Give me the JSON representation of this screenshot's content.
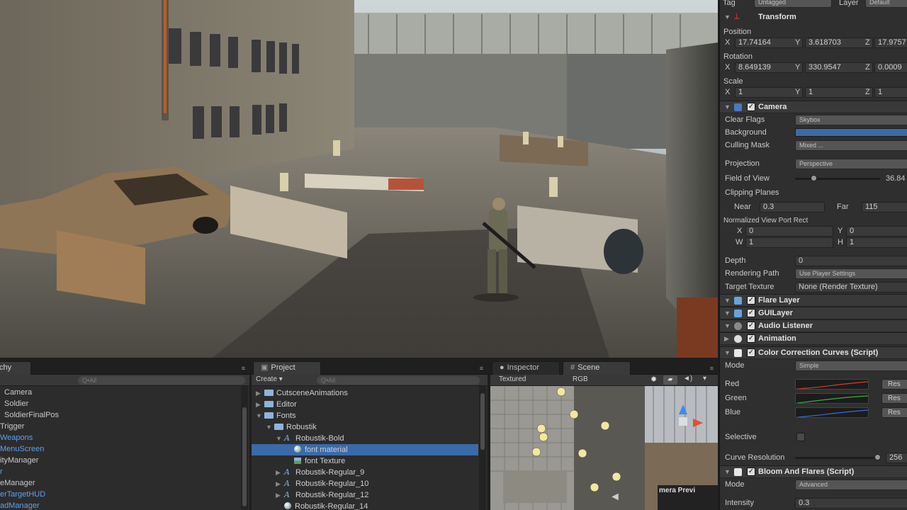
{
  "inspector": {
    "top": {
      "tag_label": "Tag",
      "tag_value": "Untagged",
      "layer_label": "Layer",
      "layer_value": "Default"
    },
    "transform": {
      "title": "Transform",
      "position_label": "Position",
      "position": {
        "x": "17.74164",
        "y": "3.618703",
        "z": "17.9757"
      },
      "rotation_label": "Rotation",
      "rotation": {
        "x": "8.649139",
        "y": "330.9547",
        "z": "0.0009"
      },
      "scale_label": "Scale",
      "scale": {
        "x": "1",
        "y": "1",
        "z": "1"
      },
      "axis": {
        "x": "X",
        "y": "Y",
        "z": "Z"
      }
    },
    "camera": {
      "title": "Camera",
      "clear_flags_label": "Clear Flags",
      "clear_flags": "Skybox",
      "background_label": "Background",
      "background_color": "#3d6aa6",
      "culling_mask_label": "Culling Mask",
      "culling_mask": "Mixed ...",
      "projection_label": "Projection",
      "projection": "Perspective",
      "fov_label": "Field of View",
      "fov": "36.84",
      "clipping_label": "Clipping Planes",
      "near_label": "Near",
      "near": "0.3",
      "far_label": "Far",
      "far": "115",
      "viewport_label": "Normalized View Port Rect",
      "vp": {
        "x_label": "X",
        "x": "0",
        "y_label": "Y",
        "y": "0",
        "w_label": "W",
        "w": "1",
        "h_label": "H",
        "h": "1"
      },
      "depth_label": "Depth",
      "depth": "0",
      "rendering_path_label": "Rendering Path",
      "rendering_path": "Use Player Settings",
      "target_texture_label": "Target Texture",
      "target_texture": "None (Render Texture)"
    },
    "components": {
      "flare_layer": "Flare Layer",
      "gui_layer": "GUILayer",
      "audio_listener": "Audio Listener",
      "animation": "Animation",
      "color_correction": "Color Correction Curves (Script)",
      "bloom": "Bloom And Flares (Script)"
    },
    "color_correction": {
      "mode_label": "Mode",
      "mode": "Simple",
      "red_label": "Red",
      "green_label": "Green",
      "blue_label": "Blue",
      "reset": "Res",
      "selective_label": "Selective",
      "curve_res_label": "Curve Resolution",
      "curve_res": "256"
    },
    "bloom": {
      "mode_label": "Mode",
      "mode": "Advanced",
      "intensity_label": "Intensity",
      "intensity": "0.3"
    }
  },
  "hierarchy": {
    "tab": "chy",
    "search_placeholder": "Q•All",
    "items": [
      {
        "label": "Camera",
        "color": "#c8c8c8"
      },
      {
        "label": "Soldier",
        "color": "#c8c8c8"
      },
      {
        "label": "SoldierFinalPos",
        "color": "#c8c8c8"
      },
      {
        "label": "Trigger",
        "color": "#c8c8c8"
      },
      {
        "label": "Weapons",
        "color": "#5fa0f0"
      },
      {
        "label": "MenuScreen",
        "color": "#5fa0f0"
      },
      {
        "label": "ityManager",
        "color": "#c8c8c8"
      },
      {
        "label": "r",
        "color": "#5fa0f0"
      },
      {
        "label": "eManager",
        "color": "#c8c8c8"
      },
      {
        "label": "erTargetHUD",
        "color": "#5fa0f0"
      },
      {
        "label": "adManager",
        "color": "#5fa0f0"
      }
    ]
  },
  "project": {
    "tab": "Project",
    "create_label": "Create",
    "search_placeholder": "Q•All",
    "items": [
      {
        "label": "CutsceneAnimations",
        "type": "folder",
        "arrow": "▶"
      },
      {
        "label": "Editor",
        "type": "folder",
        "arrow": "▶"
      },
      {
        "label": "Fonts",
        "type": "folder",
        "arrow": "▼"
      },
      {
        "label": "Robustik",
        "type": "folder",
        "arrow": "▼"
      },
      {
        "label": "Robustik-Bold",
        "type": "font",
        "arrow": "▼"
      },
      {
        "label": "font material",
        "type": "material",
        "arrow": ""
      },
      {
        "label": "font Texture",
        "type": "texture",
        "arrow": ""
      },
      {
        "label": "Robustik-Regular_9",
        "type": "font",
        "arrow": "▶"
      },
      {
        "label": "Robustik-Regular_10",
        "type": "font",
        "arrow": "▶"
      },
      {
        "label": "Robustik-Regular_12",
        "type": "font",
        "arrow": "▶"
      },
      {
        "label": "Robustik-Regular_14",
        "type": "material",
        "arrow": ""
      }
    ]
  },
  "scene": {
    "inspector_tab": "Inspector",
    "scene_tab": "Scene",
    "draw_mode": "Textured",
    "render_mode": "RGB",
    "camera_preview": "mera Previ"
  }
}
